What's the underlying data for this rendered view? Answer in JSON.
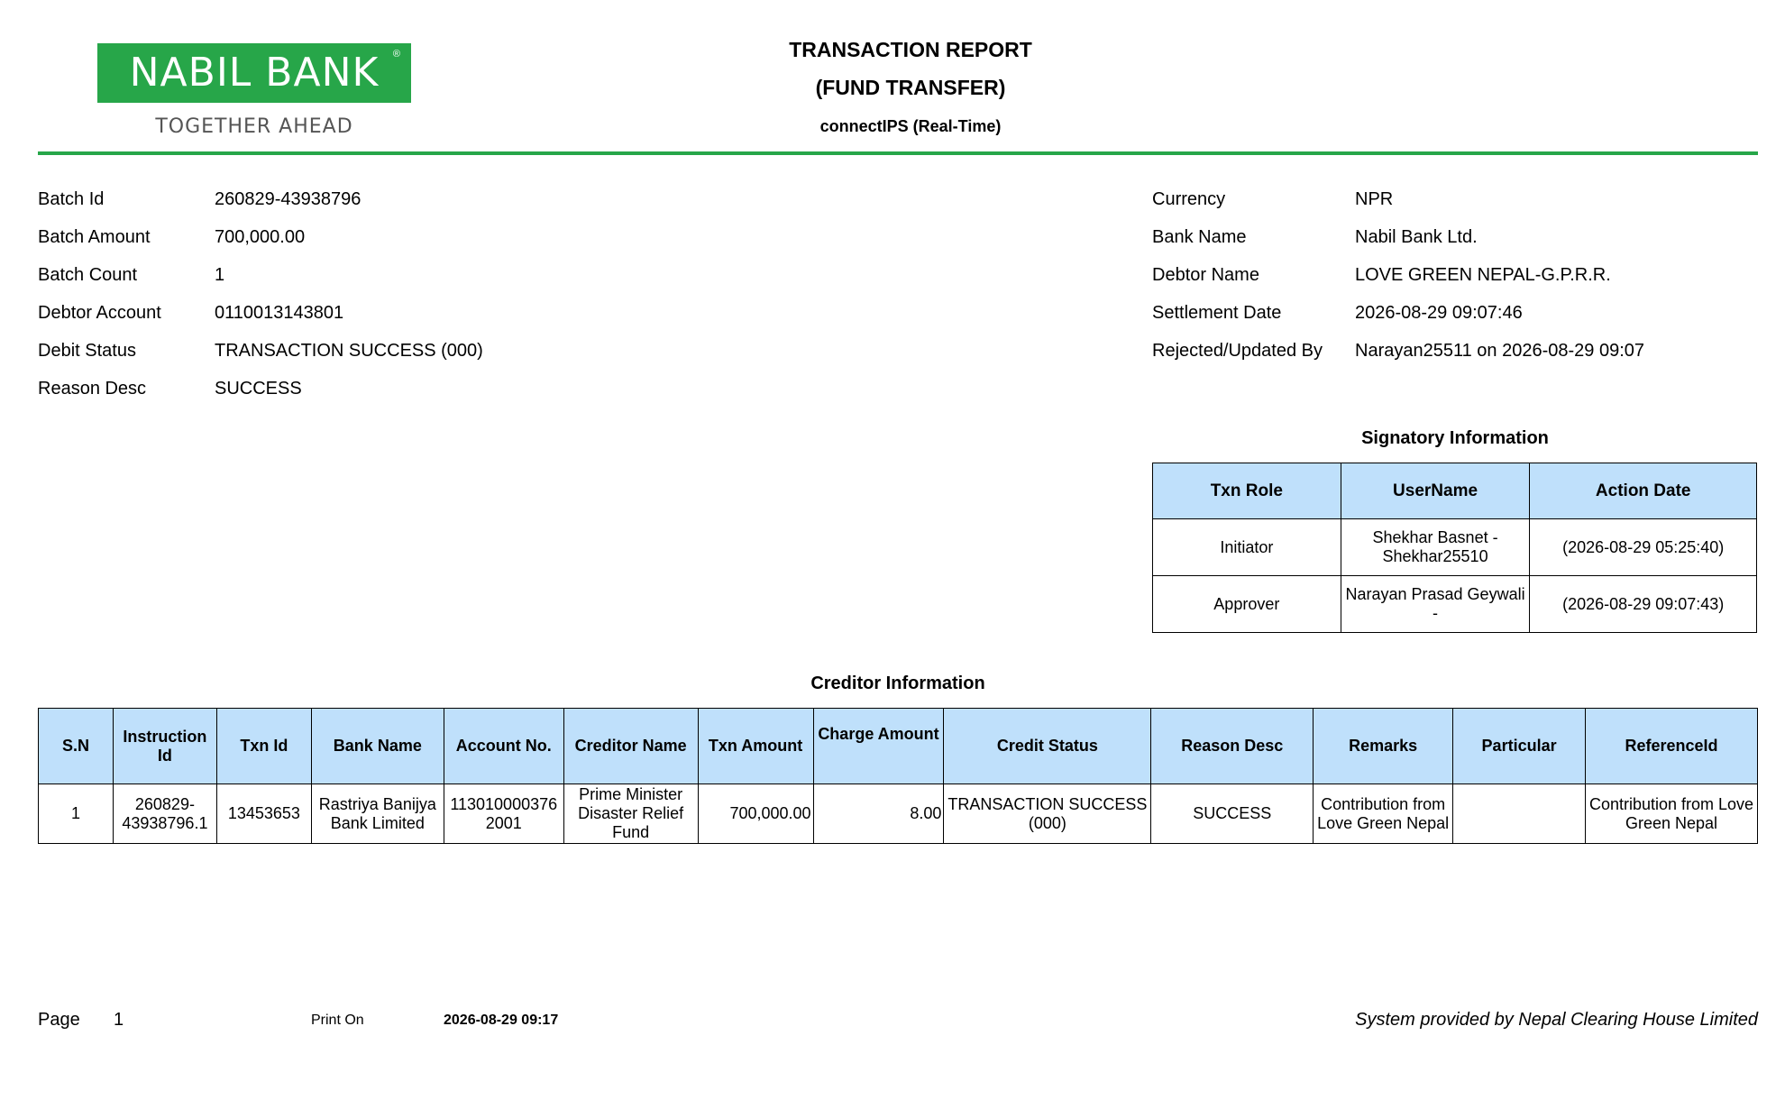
{
  "logo": {
    "text": "NABIL BANK",
    "reg": "®",
    "tagline": "TOGETHER AHEAD"
  },
  "header": {
    "title": "TRANSACTION REPORT",
    "subtitle": "(FUND TRANSFER)",
    "channel": "connectIPS (Real-Time)"
  },
  "left_fields": [
    {
      "label": "Batch Id",
      "value": "260829-43938796"
    },
    {
      "label": "Batch Amount",
      "value": "700,000.00"
    },
    {
      "label": "Batch Count",
      "value": "1"
    },
    {
      "label": "Debtor Account",
      "value": "0110013143801"
    },
    {
      "label": "Debit Status",
      "value": "TRANSACTION SUCCESS (000)"
    },
    {
      "label": "Reason Desc",
      "value": "SUCCESS"
    }
  ],
  "right_fields": [
    {
      "label": "Currency",
      "value": "NPR"
    },
    {
      "label": "Bank Name",
      "value": "Nabil Bank Ltd."
    },
    {
      "label": "Debtor Name",
      "value": "LOVE GREEN NEPAL-G.P.R.R."
    },
    {
      "label": "Settlement Date",
      "value": "2026-08-29 09:07:46"
    },
    {
      "label": "Rejected/Updated By",
      "value": "Narayan25511 on 2026-08-29 09:07"
    }
  ],
  "signatory": {
    "title": "Signatory Information",
    "headers": [
      "Txn Role",
      "UserName",
      "Action Date"
    ],
    "rows": [
      {
        "role": "Initiator",
        "user": "Shekhar Basnet - Shekhar25510",
        "date": "(2026-08-29 05:25:40)"
      },
      {
        "role": "Approver",
        "user": "Narayan Prasad Geywali -",
        "date": "(2026-08-29 09:07:43)"
      }
    ]
  },
  "creditor": {
    "title": "Creditor Information",
    "headers": [
      "S.N",
      "Instruction Id",
      "Txn Id",
      "Bank Name",
      "Account No.",
      "Creditor Name",
      "Txn Amount",
      "Charge Amount",
      "Credit Status",
      "Reason Desc",
      "Remarks",
      "Particular",
      "ReferenceId"
    ],
    "rows": [
      {
        "sn": "1",
        "instruction_id": "260829-43938796.1",
        "txn_id": "13453653",
        "bank_name": "Rastriya Banijya Bank Limited",
        "account_no": "1130100003762001",
        "creditor_name": "Prime Minister Disaster Relief Fund",
        "txn_amount": "700,000.00",
        "charge_amount": "8.00",
        "credit_status": "TRANSACTION SUCCESS (000)",
        "reason_desc": "SUCCESS",
        "remarks": "Contribution from Love Green Nepal",
        "particular": "",
        "reference_id": "Contribution from Love Green Nepal"
      }
    ]
  },
  "footer": {
    "page_label": "Page",
    "page_number": "1",
    "print_label": "Print On",
    "print_date": "2026-08-29 09:17",
    "provider": "System provided by Nepal Clearing House Limited"
  }
}
